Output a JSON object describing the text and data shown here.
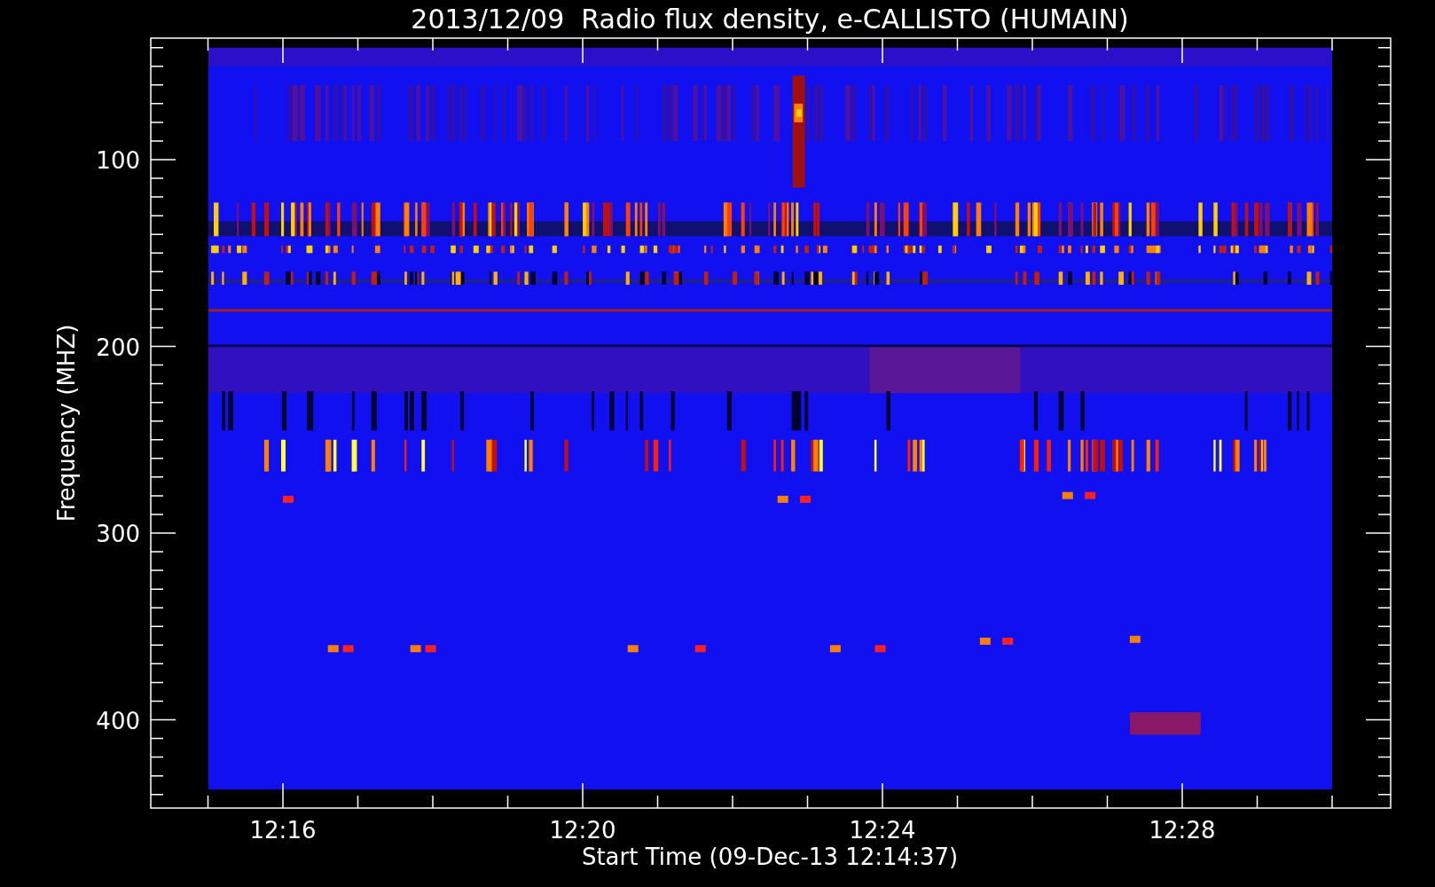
{
  "title": "2013/12/09  Radio flux density, e-CALLISTO (HUMAIN)",
  "y_axis": {
    "label": "Frequency (MHZ)",
    "ticks": [
      "100",
      "200",
      "300",
      "400"
    ]
  },
  "x_axis": {
    "label": "Start Time (09-Dec-13 12:14:37)",
    "ticks": [
      "12:16",
      "12:20",
      "12:24",
      "12:28"
    ]
  }
}
